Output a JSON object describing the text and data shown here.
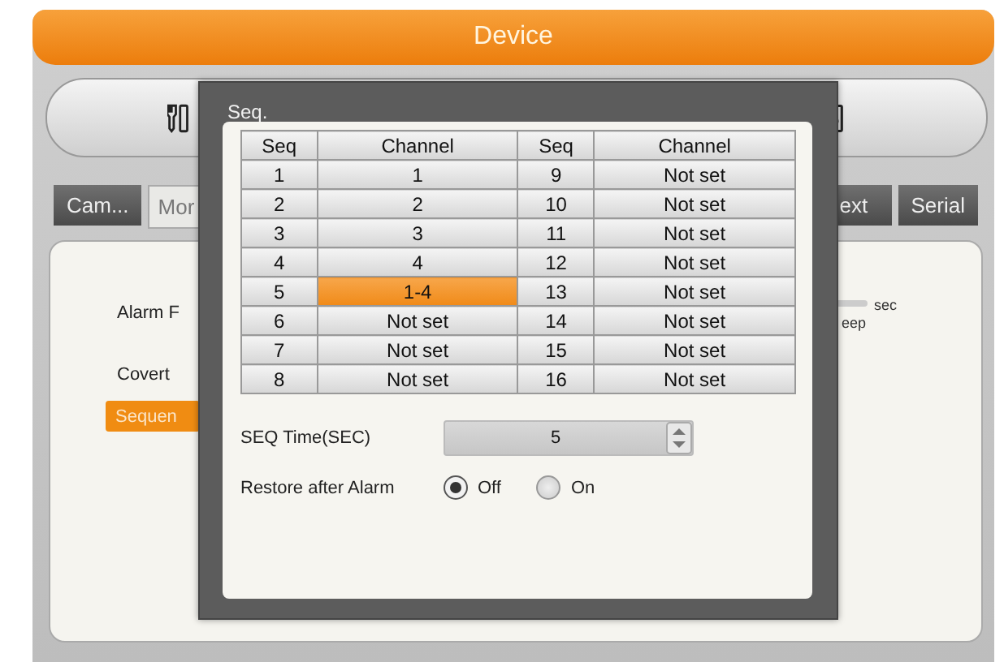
{
  "window": {
    "title": "Device"
  },
  "tabs": [
    {
      "label": "Cam...",
      "selected": false
    },
    {
      "label": "Mor",
      "selected": true
    },
    {
      "label": "ext",
      "selected": false
    },
    {
      "label": "Serial",
      "selected": false
    }
  ],
  "panel": {
    "items": [
      {
        "kind": "label",
        "text": "Alarm F"
      },
      {
        "kind": "label",
        "text": "Covert"
      },
      {
        "kind": "button",
        "text": "Sequen"
      }
    ],
    "unit": "sec",
    "caption": "eep"
  },
  "dialog": {
    "title": "Seq.",
    "columns": [
      "Seq",
      "Channel",
      "Seq",
      "Channel"
    ],
    "entries": [
      {
        "seq": "1",
        "channel": "1",
        "selected": false
      },
      {
        "seq": "2",
        "channel": "2",
        "selected": false
      },
      {
        "seq": "3",
        "channel": "3",
        "selected": false
      },
      {
        "seq": "4",
        "channel": "4",
        "selected": false
      },
      {
        "seq": "5",
        "channel": "1-4",
        "selected": true
      },
      {
        "seq": "6",
        "channel": "Not set",
        "selected": false
      },
      {
        "seq": "7",
        "channel": "Not set",
        "selected": false
      },
      {
        "seq": "8",
        "channel": "Not set",
        "selected": false
      },
      {
        "seq": "9",
        "channel": "Not set",
        "selected": false
      },
      {
        "seq": "10",
        "channel": "Not set",
        "selected": false
      },
      {
        "seq": "11",
        "channel": "Not set",
        "selected": false
      },
      {
        "seq": "12",
        "channel": "Not set",
        "selected": false
      },
      {
        "seq": "13",
        "channel": "Not set",
        "selected": false
      },
      {
        "seq": "14",
        "channel": "Not set",
        "selected": false
      },
      {
        "seq": "15",
        "channel": "Not set",
        "selected": false
      },
      {
        "seq": "16",
        "channel": "Not set",
        "selected": false
      }
    ],
    "seq_time": {
      "label": "SEQ Time(SEC)",
      "value": "5"
    },
    "restore": {
      "label": "Restore after Alarm",
      "options": [
        {
          "label": "Off",
          "selected": true
        },
        {
          "label": "On",
          "selected": false
        }
      ]
    }
  }
}
